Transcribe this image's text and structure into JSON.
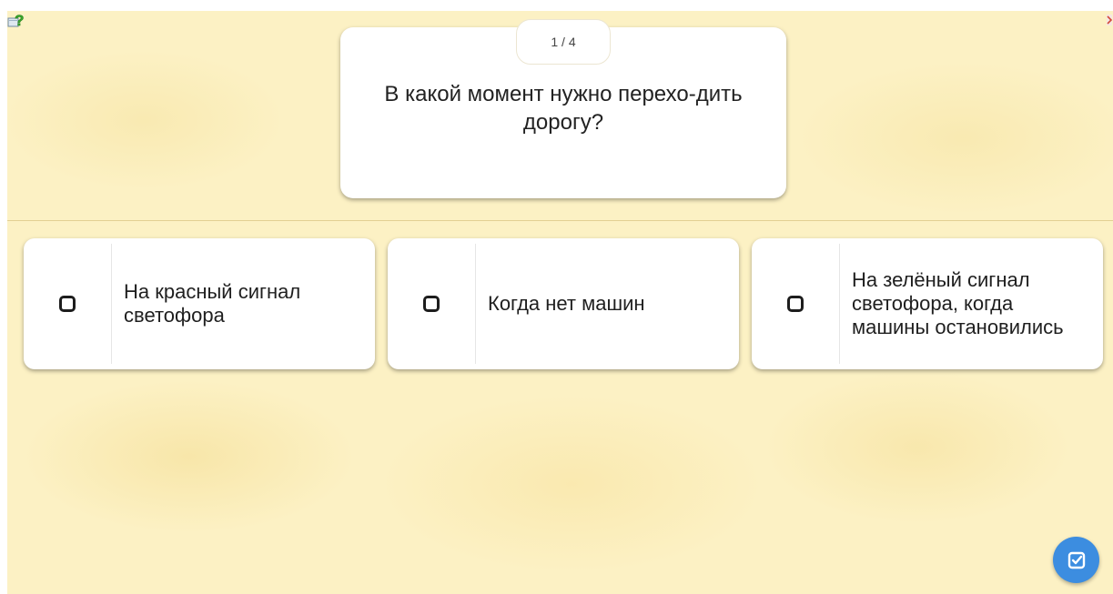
{
  "quiz": {
    "counter": "1 / 4",
    "question": "В какой момент нужно перехо-дить дорогу?"
  },
  "answers": [
    {
      "label": "На красный сигнал светофора",
      "checked": false
    },
    {
      "label": "Когда нет машин",
      "checked": false
    },
    {
      "label": "На зелёный сигнал светофора, когда машины остановились",
      "checked": false
    }
  ],
  "icons": {
    "help": "help-question-icon",
    "submit": "check-square-icon",
    "checkbox": "checkbox-empty-icon"
  },
  "colors": {
    "background": "#fcf1c4",
    "card": "#ffffff",
    "accent": "#3c8de0",
    "text": "#222222"
  }
}
